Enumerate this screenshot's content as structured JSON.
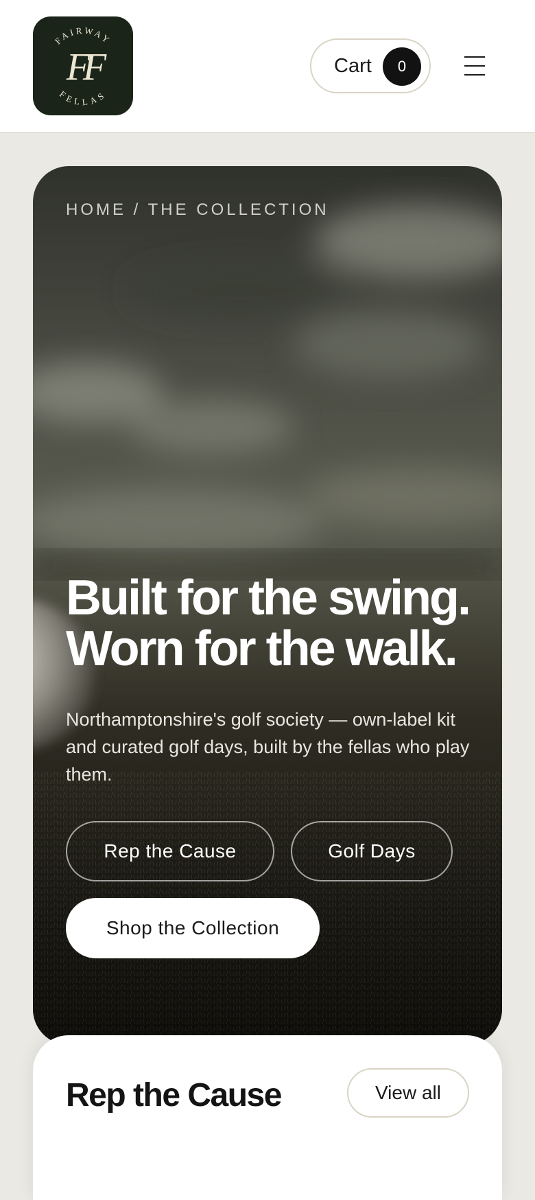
{
  "header": {
    "logo": {
      "top_text": "FAIRWAY",
      "monogram": "FF",
      "bottom_text": "FELLAS"
    },
    "cart_label": "Cart",
    "cart_count": "0",
    "menu_icon": "hamburger-menu-icon"
  },
  "hero": {
    "breadcrumb": "HOME / THE COLLECTION",
    "headline_line1": "Built for the swing.",
    "headline_line2": "Worn for the walk.",
    "subtext": "Northamptonshire's golf society — own-label kit and curated golf days, built by the fellas who play them.",
    "buttons": {
      "rep_the_cause": "Rep the Cause",
      "golf_days": "Golf Days",
      "shop_collection": "Shop the Collection"
    }
  },
  "section": {
    "title": "Rep the Cause",
    "view_all": "View all"
  },
  "colors": {
    "logo_bg": "#1a2418",
    "logo_fg": "#ece6d2",
    "page_bg": "#ebe9e4",
    "badge_bg": "#121212"
  }
}
